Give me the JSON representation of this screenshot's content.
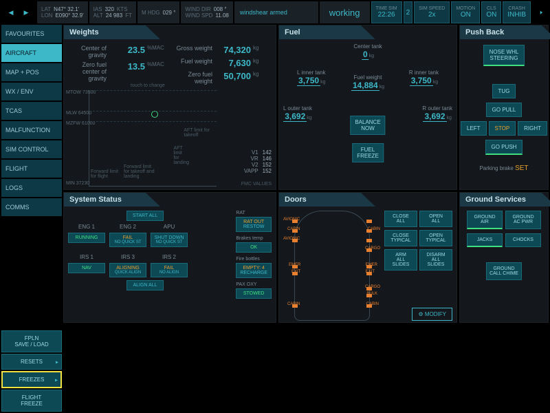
{
  "topbar": {
    "pos": {
      "lat_lbl": "LAT",
      "lat": "N47° 32.1'",
      "lon_lbl": "LON",
      "lon": "E090° 32.9'"
    },
    "ias": {
      "lbl": "IAS",
      "val": "320",
      "unit": "KTS"
    },
    "alt": {
      "lbl": "ALT",
      "val": "24 983",
      "unit": "FT"
    },
    "hdg": {
      "lbl": "M HDG",
      "val": "029 °"
    },
    "wind": {
      "dir_lbl": "WIND DIR",
      "dir": "008 °",
      "spd_lbl": "WIND SPD",
      "spd": "11.08"
    },
    "windshear": "windshear armed",
    "working": "working",
    "timesim": {
      "lbl": "TIME SIM",
      "val": "22:26"
    },
    "simspeed": {
      "lbl": "SIM SPEED",
      "val": "2x"
    },
    "motion": {
      "lbl": "MOTION",
      "val": "ON"
    },
    "cls": {
      "lbl": "CLS",
      "val": "ON"
    },
    "crash": {
      "lbl": "CRASH",
      "val": "INHIB"
    }
  },
  "sidebar": {
    "items": [
      "FAVOURITES",
      "AIRCRAFT",
      "MAP + POS",
      "WX / ENV",
      "TCAS",
      "MALFUNCTION",
      "SIM CONTROL",
      "FLIGHT",
      "LOGS",
      "COMMS"
    ],
    "bottom": [
      "FPLN\nSAVE / LOAD",
      "RESETS",
      "FREEZES",
      "FLIGHT\nFREEZE"
    ]
  },
  "weights": {
    "title": "Weights",
    "cog_lbl": "Center of gravity",
    "cog": "23.5",
    "mac": "%MAC",
    "zfcog_lbl": "Zero fuel center of\ngravity",
    "zfcog": "13.5",
    "gross_lbl": "Gross weight",
    "gross": "74,320",
    "kg": "kg",
    "fuelw_lbl": "Fuel weight",
    "fuelw": "7,630",
    "zfw_lbl": "Zero fuel weight",
    "zfw": "50,700",
    "touch": "touch to change",
    "env": {
      "mtow": "MTOW  73500",
      "mlw": "MLW   64500",
      "mzfw": "MZFW 61000",
      "min": "MIN    37230",
      "kg": "kg"
    },
    "envtxt": {
      "fwd_flight": "Forward limit\nfor flight",
      "fwd_to": "Forward limit\nfor takeoff and\nlanding",
      "aft_land": "AFT\nlimit\nfor\nlanding",
      "aft_to": "AFT limit for\ntakeoff"
    },
    "vspeeds": {
      "v1_lbl": "V1",
      "v1": "142",
      "vr_lbl": "VR",
      "vr": "146",
      "v2_lbl": "V2",
      "v2": "152",
      "vapp_lbl": "VAPP",
      "vapp": "152"
    },
    "fmc": "FMC VALUES"
  },
  "fuel": {
    "title": "Fuel",
    "center_lbl": "Center tank",
    "center": "0",
    "li_lbl": "L inner tank",
    "li": "3,750",
    "ri_lbl": "R inner tank",
    "ri": "3,750",
    "lo_lbl": "L outer tank",
    "lo": "3,692",
    "ro_lbl": "R outer tank",
    "ro": "3,692",
    "fw_lbl": "Fuel weight",
    "fw": "14,884",
    "kg": "kg",
    "balance": "BALANCE\nNOW",
    "freeze": "FUEL\nFREEZE"
  },
  "pushback": {
    "title": "Push Back",
    "nosewhl": "NOSE WHL\nSTEERING",
    "tug": "TUG",
    "gopull": "GO PULL",
    "left": "LEFT",
    "stop": "STOP",
    "right": "RIGHT",
    "gopush": "GO PUSH",
    "pbrake_lbl": "Parking brake",
    "pbrake": "SET"
  },
  "sysstatus": {
    "title": "System Status",
    "startall": "START ALL",
    "eng1_lbl": "ENG 1",
    "eng1": "RUNNING",
    "eng2_lbl": "ENG 2",
    "eng2_t": "FAIL",
    "eng2_b": "NO QUICK ST",
    "apu_lbl": "APU",
    "apu_t": "SHUT DOWN",
    "apu_b": "NO QUICK ST",
    "irs1_lbl": "IRS 1",
    "irs1": "NAV",
    "irs3_lbl": "IRS 3",
    "irs3_t": "ALIGNING",
    "irs3_b": "QUICK ALIGN",
    "irs2_lbl": "IRS 2",
    "irs2_t": "FAIL",
    "irs2_b": "NO ALIGN",
    "alignall": "ALIGN ALL",
    "rat_lbl": "RAT",
    "rat_t": "RAT OUT",
    "rat_b": "RESTOW",
    "brakes_lbl": "Brakes temp",
    "brakes": "OK",
    "fire_lbl": "Fire bottles",
    "fire_t": "EMPTY: 4",
    "fire_b": "RECHARGE",
    "pax_lbl": "PAX OXY",
    "pax": "STOWED"
  },
  "doors": {
    "title": "Doors",
    "labels": {
      "avionic": "AVIONIC",
      "cabin": "CABIN",
      "cargo": "CARGO",
      "emer": "EMER",
      "exit": "EXIT",
      "bulk": "BULK"
    },
    "closeall": "CLOSE\nALL",
    "openall": "OPEN\nALL",
    "closetyp": "CLOSE\nTYPICAL",
    "opentyp": "OPEN\nTYPICAL",
    "arm": "ARM\nALL SLIDES",
    "disarm": "DISARM\nALL SLIDES",
    "modify": "MODIFY"
  },
  "ground": {
    "title": "Ground Services",
    "air": "GROUND\nAIR",
    "acpwr": "GROUND\nAC PWR",
    "jacks": "JACKS",
    "chocks": "CHOCKS",
    "chime": "GROUND\nCALL CHIME"
  }
}
